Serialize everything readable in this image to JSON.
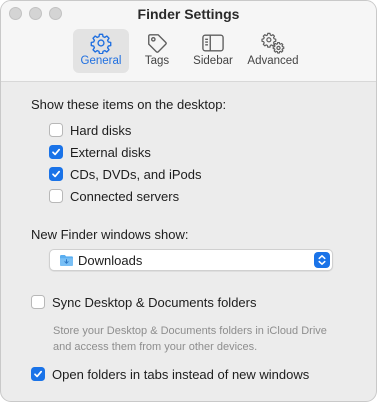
{
  "window": {
    "title": "Finder Settings"
  },
  "toolbar": {
    "tabs": [
      {
        "label": "General",
        "icon": "gear-icon",
        "selected": true
      },
      {
        "label": "Tags",
        "icon": "tag-icon",
        "selected": false
      },
      {
        "label": "Sidebar",
        "icon": "sidebar-icon",
        "selected": false
      },
      {
        "label": "Advanced",
        "icon": "gears-icon",
        "selected": false
      }
    ]
  },
  "desktop": {
    "heading": "Show these items on the desktop:",
    "items": [
      {
        "label": "Hard disks",
        "checked": false
      },
      {
        "label": "External disks",
        "checked": true
      },
      {
        "label": "CDs, DVDs, and iPods",
        "checked": true
      },
      {
        "label": "Connected servers",
        "checked": false
      }
    ]
  },
  "new_window": {
    "heading": "New Finder windows show:",
    "selected": "Downloads",
    "icon": "folder-icon"
  },
  "sync": {
    "label": "Sync Desktop & Documents folders",
    "checked": false,
    "description": "Store your Desktop & Documents folders in iCloud Drive and access them from your other devices."
  },
  "tabs_option": {
    "label": "Open folders in tabs instead of new windows",
    "checked": true
  },
  "colors": {
    "accent": "#1a73e8",
    "window_bg": "#ececec",
    "titlebar_bg": "#f6f6f6",
    "secondary_text": "#8e8e8e"
  }
}
